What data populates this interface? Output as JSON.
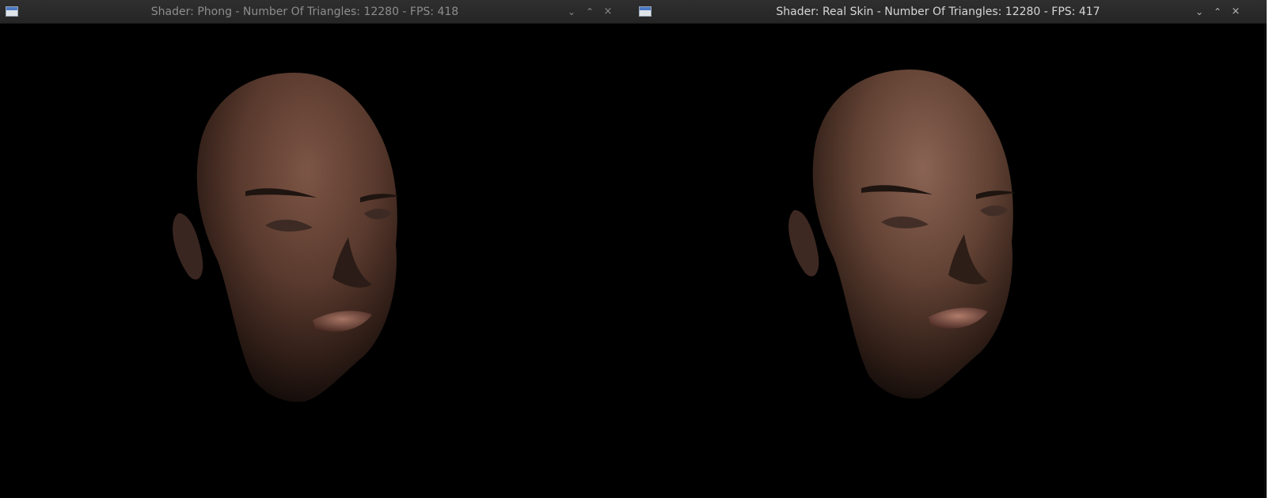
{
  "windows": [
    {
      "title": "Shader: Phong - Number Of Triangles: 12280 - FPS: 418",
      "controls": {
        "minimize": "⌄",
        "maximize": "⌃",
        "close": "×"
      },
      "icon": "window-icon",
      "viewport_content": "3d-head-model"
    },
    {
      "title": "Shader: Real Skin - Number Of Triangles: 12280 - FPS: 417",
      "controls": {
        "minimize": "⌄",
        "maximize": "⌃",
        "close": "×"
      },
      "icon": "window-icon",
      "viewport_content": "3d-head-model"
    }
  ],
  "colors": {
    "titlebar": "#2a2a2a",
    "viewport_bg": "#000000",
    "skin_highlight_left": "#7a5444",
    "skin_highlight_right": "#8a6656"
  }
}
